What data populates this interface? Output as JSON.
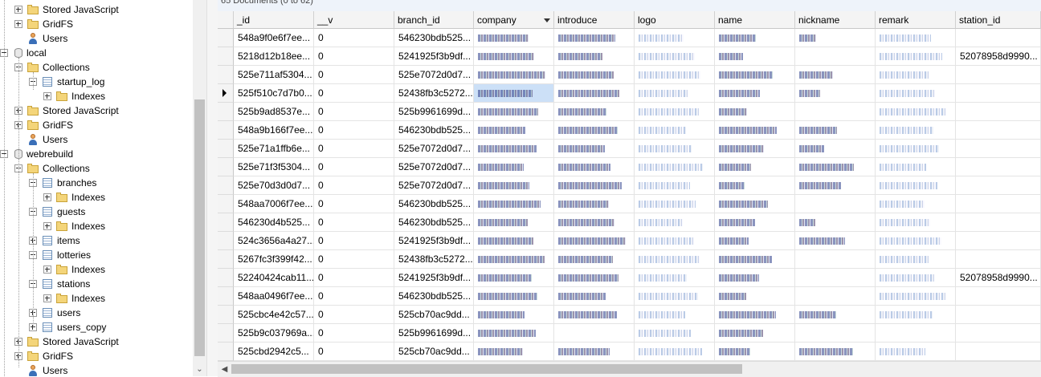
{
  "tree": {
    "items": [
      {
        "label": "Stored JavaScript",
        "icon": "folder-icon",
        "depth": 1,
        "expander": "plus"
      },
      {
        "label": "GridFS",
        "icon": "folder-icon",
        "depth": 1,
        "expander": "plus"
      },
      {
        "label": "Users",
        "icon": "user-icon",
        "depth": 1,
        "expander": "none"
      },
      {
        "label": "local",
        "icon": "database-icon",
        "depth": 0,
        "expander": "minus"
      },
      {
        "label": "Collections",
        "icon": "folder-icon",
        "depth": 1,
        "expander": "minus"
      },
      {
        "label": "startup_log",
        "icon": "collection-icon",
        "depth": 2,
        "expander": "minus"
      },
      {
        "label": "Indexes",
        "icon": "folder-icon",
        "depth": 3,
        "expander": "plus"
      },
      {
        "label": "Stored JavaScript",
        "icon": "folder-icon",
        "depth": 1,
        "expander": "plus"
      },
      {
        "label": "GridFS",
        "icon": "folder-icon",
        "depth": 1,
        "expander": "plus"
      },
      {
        "label": "Users",
        "icon": "user-icon",
        "depth": 1,
        "expander": "none"
      },
      {
        "label": "webrebuild",
        "icon": "database-icon",
        "depth": 0,
        "expander": "minus"
      },
      {
        "label": "Collections",
        "icon": "folder-icon",
        "depth": 1,
        "expander": "minus"
      },
      {
        "label": "branches",
        "icon": "collection-icon",
        "depth": 2,
        "expander": "minus"
      },
      {
        "label": "Indexes",
        "icon": "folder-icon",
        "depth": 3,
        "expander": "plus"
      },
      {
        "label": "guests",
        "icon": "collection-icon",
        "depth": 2,
        "expander": "minus"
      },
      {
        "label": "Indexes",
        "icon": "folder-icon",
        "depth": 3,
        "expander": "plus"
      },
      {
        "label": "items",
        "icon": "collection-icon",
        "depth": 2,
        "expander": "plus"
      },
      {
        "label": "lotteries",
        "icon": "collection-icon",
        "depth": 2,
        "expander": "minus"
      },
      {
        "label": "Indexes",
        "icon": "folder-icon",
        "depth": 3,
        "expander": "plus"
      },
      {
        "label": "stations",
        "icon": "collection-icon",
        "depth": 2,
        "expander": "minus"
      },
      {
        "label": "Indexes",
        "icon": "folder-icon",
        "depth": 3,
        "expander": "plus"
      },
      {
        "label": "users",
        "icon": "collection-icon",
        "depth": 2,
        "expander": "plus"
      },
      {
        "label": "users_copy",
        "icon": "collection-icon",
        "depth": 2,
        "expander": "plus"
      },
      {
        "label": "Stored JavaScript",
        "icon": "folder-icon",
        "depth": 1,
        "expander": "plus"
      },
      {
        "label": "GridFS",
        "icon": "folder-icon",
        "depth": 1,
        "expander": "plus"
      },
      {
        "label": "Users",
        "icon": "user-icon",
        "depth": 1,
        "expander": "none"
      }
    ]
  },
  "grid": {
    "doc_count": "65 Documents (0 to 62)",
    "columns": [
      "_id",
      "__v",
      "branch_id",
      "company",
      "introduce",
      "logo",
      "name",
      "nickname",
      "remark",
      "station_id"
    ],
    "sorted_column": "company",
    "selected_row": 3,
    "rows": [
      {
        "id": "548a9f0e6f7ee...",
        "v": "0",
        "branch": "546230bdb525...",
        "station": ""
      },
      {
        "id": "5218d12b18ee...",
        "v": "0",
        "branch": "5241925f3b9df...",
        "station": "52078958d9990..."
      },
      {
        "id": "525e711af5304...",
        "v": "0",
        "branch": "525e7072d0d7...",
        "station": ""
      },
      {
        "id": "525f510c7d7b0...",
        "v": "0",
        "branch": "52438fb3c5272...",
        "station": ""
      },
      {
        "id": "525b9ad8537e...",
        "v": "0",
        "branch": "525b9961699d...",
        "station": ""
      },
      {
        "id": "548a9b166f7ee...",
        "v": "0",
        "branch": "546230bdb525...",
        "station": ""
      },
      {
        "id": "525e71a1ffb6e...",
        "v": "0",
        "branch": "525e7072d0d7...",
        "station": ""
      },
      {
        "id": "525e71f3f5304...",
        "v": "0",
        "branch": "525e7072d0d7...",
        "station": ""
      },
      {
        "id": "525e70d3d0d7...",
        "v": "0",
        "branch": "525e7072d0d7...",
        "station": ""
      },
      {
        "id": "548aa7006f7ee...",
        "v": "0",
        "branch": "546230bdb525...",
        "station": ""
      },
      {
        "id": "546230d4b525...",
        "v": "0",
        "branch": "546230bdb525...",
        "station": ""
      },
      {
        "id": "524c3656a4a27...",
        "v": "0",
        "branch": "5241925f3b9df...",
        "station": ""
      },
      {
        "id": "5267fc3f399f42...",
        "v": "0",
        "branch": "52438fb3c5272...",
        "station": ""
      },
      {
        "id": "52240424cab11...",
        "v": "0",
        "branch": "5241925f3b9df...",
        "station": "52078958d9990..."
      },
      {
        "id": "548aa0496f7ee...",
        "v": "0",
        "branch": "546230bdb525...",
        "station": ""
      },
      {
        "id": "525cbc4e42c57...",
        "v": "0",
        "branch": "525cb70ac9dd...",
        "station": ""
      },
      {
        "id": "525b9c037969a...",
        "v": "0",
        "branch": "525b9961699d...",
        "station": ""
      },
      {
        "id": "525cbd2942c5...",
        "v": "0",
        "branch": "525cb70ac9dd...",
        "station": ""
      }
    ]
  }
}
